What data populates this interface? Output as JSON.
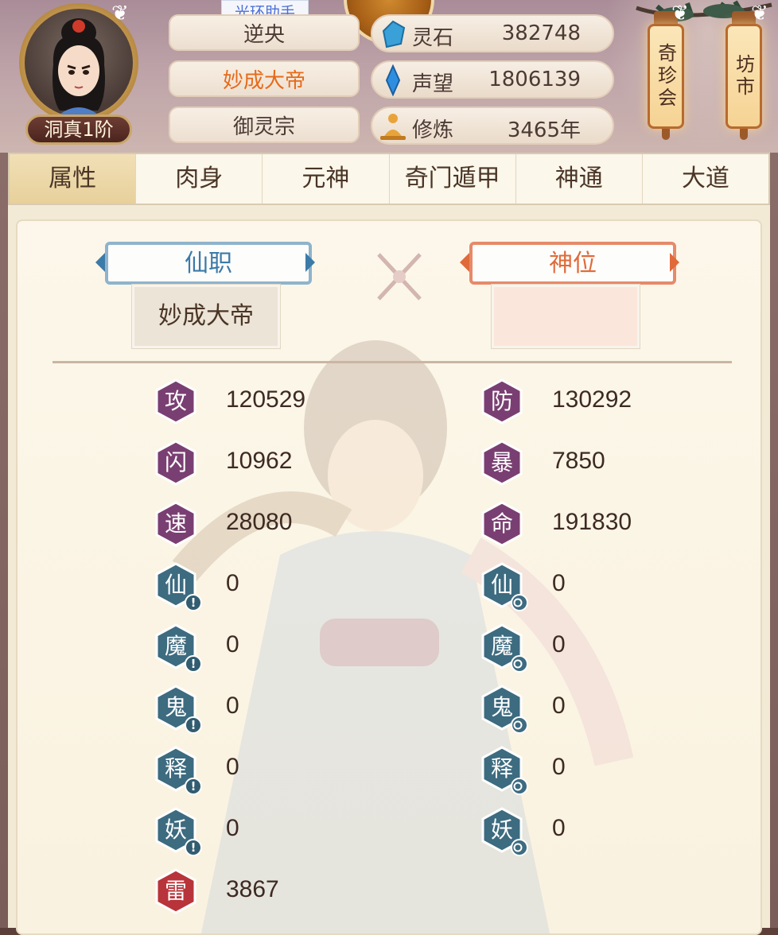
{
  "header": {
    "helper_tag": "光环助手",
    "name_partial": "逆央",
    "title": "妙成大帝",
    "sect": "御灵宗",
    "rank": "洞真1阶",
    "resources": [
      {
        "icon": "spirit-stone-icon",
        "label": "灵石",
        "value": "382748"
      },
      {
        "icon": "prestige-crystal-icon",
        "label": "声望",
        "value": "1806139"
      },
      {
        "icon": "cultivation-meditation-icon",
        "label": "修炼",
        "value": "3465年"
      }
    ],
    "lanterns": [
      {
        "label": "奇珍会"
      },
      {
        "label": "坊市"
      }
    ]
  },
  "tabs": [
    {
      "label": "属性",
      "active": true
    },
    {
      "label": "肉身",
      "active": false
    },
    {
      "label": "元神",
      "active": false
    },
    {
      "label": "奇门遁甲",
      "active": false
    },
    {
      "label": "神通",
      "active": false
    },
    {
      "label": "大道",
      "active": false
    }
  ],
  "panel": {
    "xianzhi_label": "仙职",
    "xianzhi_value": "妙成大帝",
    "shenwei_label": "神位",
    "shenwei_value": ""
  },
  "stats_left": [
    {
      "glyph": "攻",
      "value": "120529",
      "kind": "purple"
    },
    {
      "glyph": "闪",
      "value": "10962",
      "kind": "purple"
    },
    {
      "glyph": "速",
      "value": "28080",
      "kind": "purple"
    },
    {
      "glyph": "仙",
      "value": "0",
      "kind": "blue",
      "mark": "!"
    },
    {
      "glyph": "魔",
      "value": "0",
      "kind": "blue",
      "mark": "!"
    },
    {
      "glyph": "鬼",
      "value": "0",
      "kind": "blue",
      "mark": "!"
    },
    {
      "glyph": "释",
      "value": "0",
      "kind": "blue",
      "mark": "!"
    },
    {
      "glyph": "妖",
      "value": "0",
      "kind": "blue",
      "mark": "!"
    },
    {
      "glyph": "雷",
      "value": "3867",
      "kind": "red"
    }
  ],
  "stats_right": [
    {
      "glyph": "防",
      "value": "130292",
      "kind": "purple"
    },
    {
      "glyph": "暴",
      "value": "7850",
      "kind": "purple"
    },
    {
      "glyph": "命",
      "value": "191830",
      "kind": "purple"
    },
    {
      "glyph": "仙",
      "value": "0",
      "kind": "blue",
      "mark": "o"
    },
    {
      "glyph": "魔",
      "value": "0",
      "kind": "blue",
      "mark": "o"
    },
    {
      "glyph": "鬼",
      "value": "0",
      "kind": "blue",
      "mark": "o"
    },
    {
      "glyph": "释",
      "value": "0",
      "kind": "blue",
      "mark": "o"
    },
    {
      "glyph": "妖",
      "value": "0",
      "kind": "blue",
      "mark": "o"
    }
  ],
  "colors": {
    "purple": "#7a3f72",
    "blue": "#3d6b80",
    "red": "#b8343a",
    "orange_text": "#e66a1a",
    "blue_text": "#3c7aa8"
  }
}
